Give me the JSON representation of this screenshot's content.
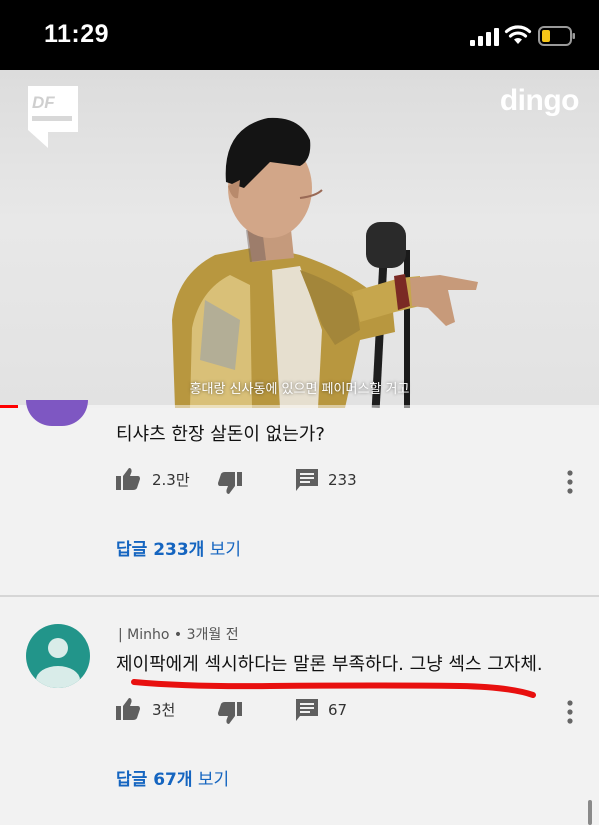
{
  "status_bar": {
    "time": "11:29"
  },
  "video": {
    "channel_logo": "dingo",
    "show_logo_text": "DF",
    "subtitle": "홍대랑 신사동에 있으면 페이머스할 거고",
    "progress_fraction": 0.03,
    "progress_color": "#ff0000"
  },
  "comments": [
    {
      "text": "티샤츠 한장 살돈이 없는가?",
      "likes": "2.3만",
      "replies_count": "233",
      "replies_link_strong": "답글 233개",
      "replies_link_rest": " 보기",
      "avatar_color": "#7e57c2"
    },
    {
      "author": "| Minho",
      "separator": "•",
      "time": "3개월 전",
      "text": "제이팍에게 섹시하다는 말론 부족하다. 그냥 섹스 그자체.",
      "likes": "3천",
      "replies_count": "67",
      "replies_link_strong": "답글 67개",
      "replies_link_rest": " 보기",
      "avatar_color": "#22958a",
      "underline_color": "#e8100f"
    }
  ],
  "icons": {
    "like": "thumbs-up-icon",
    "dislike": "thumbs-down-icon",
    "reply": "comment-icon",
    "more": "more-vertical-icon"
  }
}
